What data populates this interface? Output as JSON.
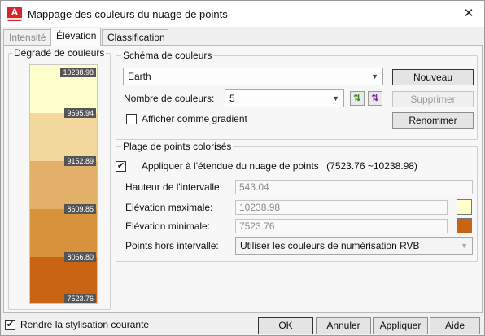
{
  "window": {
    "title": "Mappage des couleurs du nuage de points",
    "app_icon": "A"
  },
  "tabs": [
    {
      "label": "Intensité"
    },
    {
      "label": "Élévation"
    },
    {
      "label": "Classification"
    }
  ],
  "gradient": {
    "title": "Dégradé de couleurs",
    "bands": [
      {
        "color": "#ffffcc",
        "label": "10238.98"
      },
      {
        "color": "#f2d89c",
        "label": "9695.94"
      },
      {
        "color": "#e3b06a",
        "label": "9152.89"
      },
      {
        "color": "#d8923c",
        "label": "8609.85"
      },
      {
        "color": "#c96414",
        "label": "8066.80"
      },
      {
        "color": "#c96414",
        "label": "7523.76"
      }
    ]
  },
  "scheme": {
    "title": "Schéma de couleurs",
    "selected": "Earth",
    "count_label": "Nombre de couleurs:",
    "count_value": "5",
    "gradient_label": "Afficher comme gradient",
    "gradient_checked": false,
    "new_button": "Nouveau",
    "delete_button": "Supprimer",
    "rename_button": "Renommer"
  },
  "range": {
    "title": "Plage de points colorisés",
    "apply_label": "Appliquer à l'étendue du nuage de points",
    "apply_checked": true,
    "range_text": "(7523.76 ~10238.98)",
    "interval_label": "Hauteur de l'intervalle:",
    "interval_value": "543.04",
    "max_label": "Elévation maximale:",
    "max_value": "10238.98",
    "max_color": "#ffffcc",
    "min_label": "Elévation minimale:",
    "min_value": "7523.76",
    "min_color": "#c96414",
    "outside_label": "Points hors intervalle:",
    "outside_value": "Utiliser les couleurs de numérisation RVB"
  },
  "footer": {
    "apply_style_label": "Rendre la stylisation courante",
    "apply_style_checked": true,
    "ok": "OK",
    "cancel": "Annuler",
    "apply": "Appliquer",
    "help": "Aide"
  }
}
